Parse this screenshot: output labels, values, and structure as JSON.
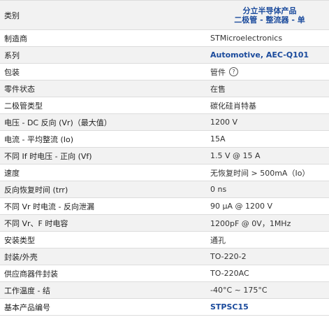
{
  "rows": [
    {
      "label": "类别",
      "value_line1": "分立半导体产品",
      "value_line2": "二极管 - 整流器 - 单",
      "link": true
    },
    {
      "label": "制造商",
      "value": "STMicroelectronics",
      "link": false
    },
    {
      "label": "系列",
      "value": "Automotive, AEC-Q101",
      "link": true
    },
    {
      "label": "包装",
      "value": "管件",
      "link": false,
      "icon": "help-circle-icon",
      "icon_glyph": "?"
    },
    {
      "label": "零件状态",
      "value": "在售",
      "link": false
    },
    {
      "label": "二极管类型",
      "value": "碳化硅肖特基",
      "link": false
    },
    {
      "label": "电压 - DC 反向 (Vr)（最大值）",
      "value": "1200 V",
      "link": false
    },
    {
      "label": "电流 - 平均整流 (Io)",
      "value": "15A",
      "link": false
    },
    {
      "label": "不同 If 时电压 - 正向 (Vf)",
      "value": "1.5 V @ 15 A",
      "link": false
    },
    {
      "label": "速度",
      "value": "无恢复时间 > 500mA（Io）",
      "link": false
    },
    {
      "label": "反向恢复时间 (trr)",
      "value": "0 ns",
      "link": false
    },
    {
      "label": "不同 Vr 时电流 - 反向泄漏",
      "value": "90 µA @ 1200 V",
      "link": false
    },
    {
      "label": "不同 Vr、F 时电容",
      "value": "1200pF @ 0V，1MHz",
      "link": false
    },
    {
      "label": "安装类型",
      "value": "通孔",
      "link": false
    },
    {
      "label": "封装/外壳",
      "value": "TO-220-2",
      "link": false
    },
    {
      "label": "供应商器件封装",
      "value": "TO-220AC",
      "link": false
    },
    {
      "label": "工作温度 - 结",
      "value": "-40°C ~ 175°C",
      "link": false
    },
    {
      "label": "基本产品编号",
      "value": "STPSC15",
      "link": true
    }
  ]
}
